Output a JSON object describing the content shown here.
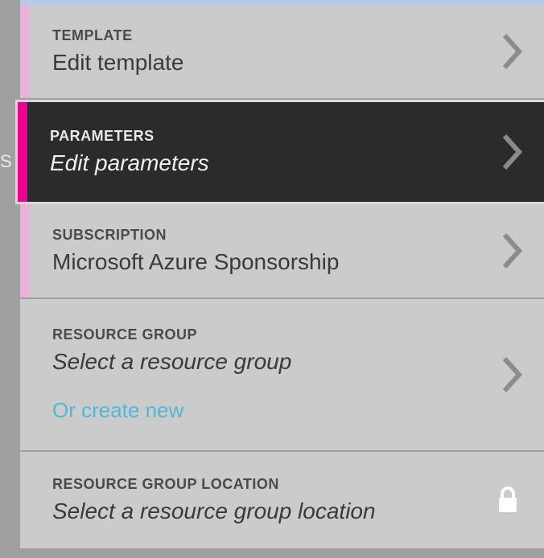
{
  "leftTabChar": "S",
  "items": {
    "template": {
      "label": "TEMPLATE",
      "value": "Edit template"
    },
    "parameters": {
      "label": "PARAMETERS",
      "value": "Edit parameters"
    },
    "subscription": {
      "label": "SUBSCRIPTION",
      "value": "Microsoft Azure Sponsorship"
    },
    "resourceGroup": {
      "label": "RESOURCE GROUP",
      "value": "Select a resource group",
      "createNew": "Or create new"
    },
    "location": {
      "label": "RESOURCE GROUP LOCATION",
      "value": "Select a resource group location"
    }
  },
  "colors": {
    "accentLight": "#e8b3d9",
    "accentMagenta": "#ec008c",
    "link": "#4fb8d6"
  }
}
